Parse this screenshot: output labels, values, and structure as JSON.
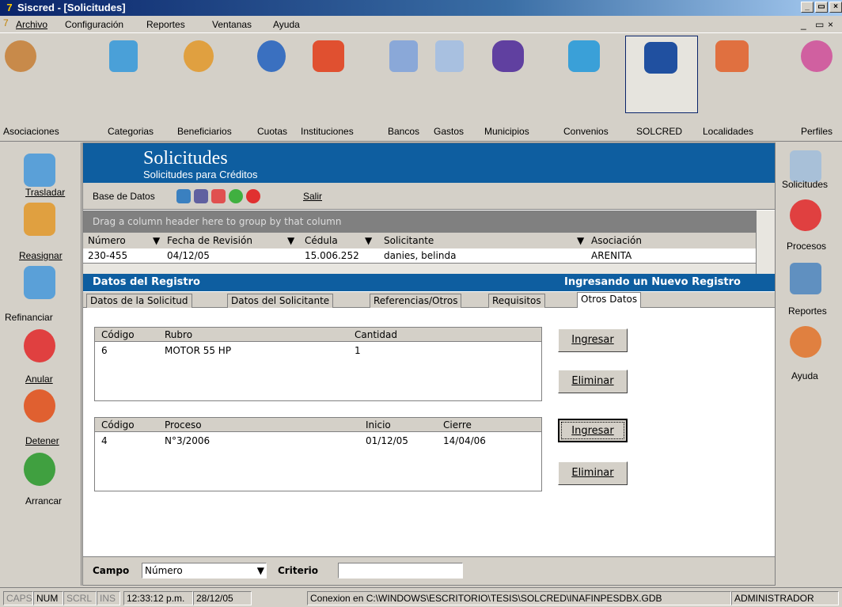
{
  "window": {
    "title": "Siscred - [Solicitudes]"
  },
  "menu": [
    "Archivo",
    "Configuración",
    "Reportes",
    "Ventanas",
    "Ayuda"
  ],
  "toolbar": [
    {
      "label": "Asociaciones",
      "icon": "people-icon",
      "color": "#c88a4a"
    },
    {
      "label": "Categorias",
      "icon": "shapes-icon",
      "color": "#4aa0d8"
    },
    {
      "label": "Beneficiarios",
      "icon": "person-icon",
      "color": "#e0a040"
    },
    {
      "label": "Cuotas",
      "icon": "coin-icon",
      "color": "#3a70c0"
    },
    {
      "label": "Instituciones",
      "icon": "house-icon",
      "color": "#e05030"
    },
    {
      "label": "Bancos",
      "icon": "bank-icon",
      "color": "#8aa8d8"
    },
    {
      "label": "Gastos",
      "icon": "document-icon",
      "color": "#a8c0e0"
    },
    {
      "label": "Municipios",
      "icon": "map-icon",
      "color": "#6040a0"
    },
    {
      "label": "Convenios",
      "icon": "contract-icon",
      "color": "#3aa0d8"
    },
    {
      "label": "SOLCRED",
      "icon": "solcred-icon",
      "color": "#2050a0"
    },
    {
      "label": "Localidades",
      "icon": "houses-icon",
      "color": "#e07040"
    },
    {
      "label": "Perfiles",
      "icon": "profiles-icon",
      "color": "#d060a0"
    }
  ],
  "left_sidebar": [
    {
      "label": "Trasladar",
      "icon": "move-icon"
    },
    {
      "label": "Reasignar",
      "icon": "reassign-icon"
    },
    {
      "label": "Refinanciar",
      "icon": "refinance-icon"
    },
    {
      "label": "Anular",
      "icon": "cancel-icon"
    },
    {
      "label": "Detener",
      "icon": "stop-icon"
    },
    {
      "label": "Arrancar",
      "icon": "start-icon"
    }
  ],
  "right_sidebar": [
    {
      "label": "Solicitudes",
      "icon": "form-icon"
    },
    {
      "label": "Procesos",
      "icon": "clock-icon"
    },
    {
      "label": "Reportes",
      "icon": "printer-icon"
    },
    {
      "label": "Ayuda",
      "icon": "help-icon"
    }
  ],
  "header": {
    "title": "Solicitudes",
    "subtitle": "Solicitudes para Créditos"
  },
  "subtoolbar": {
    "db_label": "Base de Datos",
    "exit_label": "Salir"
  },
  "grid": {
    "group_hint": "Drag a column header here to group by that column",
    "columns": [
      "Número",
      "Fecha de Revisión",
      "Cédula",
      "Solicitante",
      "Asociación"
    ],
    "row": [
      "230-455",
      "04/12/05",
      "15.006.252",
      "danies, belinda",
      "ARENITA"
    ]
  },
  "record_bar": {
    "title": "Datos del Registro",
    "status": "Ingresando un Nuevo Registro"
  },
  "tabs": [
    "Datos de la Solicitud",
    "Datos del Solicitante",
    "Referencias/Otros",
    "Requisitos",
    "Otros Datos"
  ],
  "items_table": {
    "columns": [
      "Código",
      "Rubro",
      "Cantidad"
    ],
    "rows": [
      [
        "6",
        "MOTOR 55 HP",
        "1"
      ]
    ]
  },
  "process_table": {
    "columns": [
      "Código",
      "Proceso",
      "Inicio",
      "Cierre"
    ],
    "rows": [
      [
        "4",
        "N°3/2006",
        "01/12/05",
        "14/04/06"
      ]
    ]
  },
  "buttons": {
    "add": "Ingresar",
    "remove": "Eliminar"
  },
  "search": {
    "field_label": "Campo",
    "field_value": "Número",
    "criteria_label": "Criterio",
    "criteria_value": ""
  },
  "status": [
    "CAPS",
    "NUM",
    "SCRL",
    "INS",
    "12:33:12 p.m.",
    "28/12/05",
    "Conexion en C:\\WINDOWS\\ESCRITORIO\\TESIS\\SOLCRED\\INAFINPESDBX.GDB",
    "ADMINISTRADOR"
  ]
}
